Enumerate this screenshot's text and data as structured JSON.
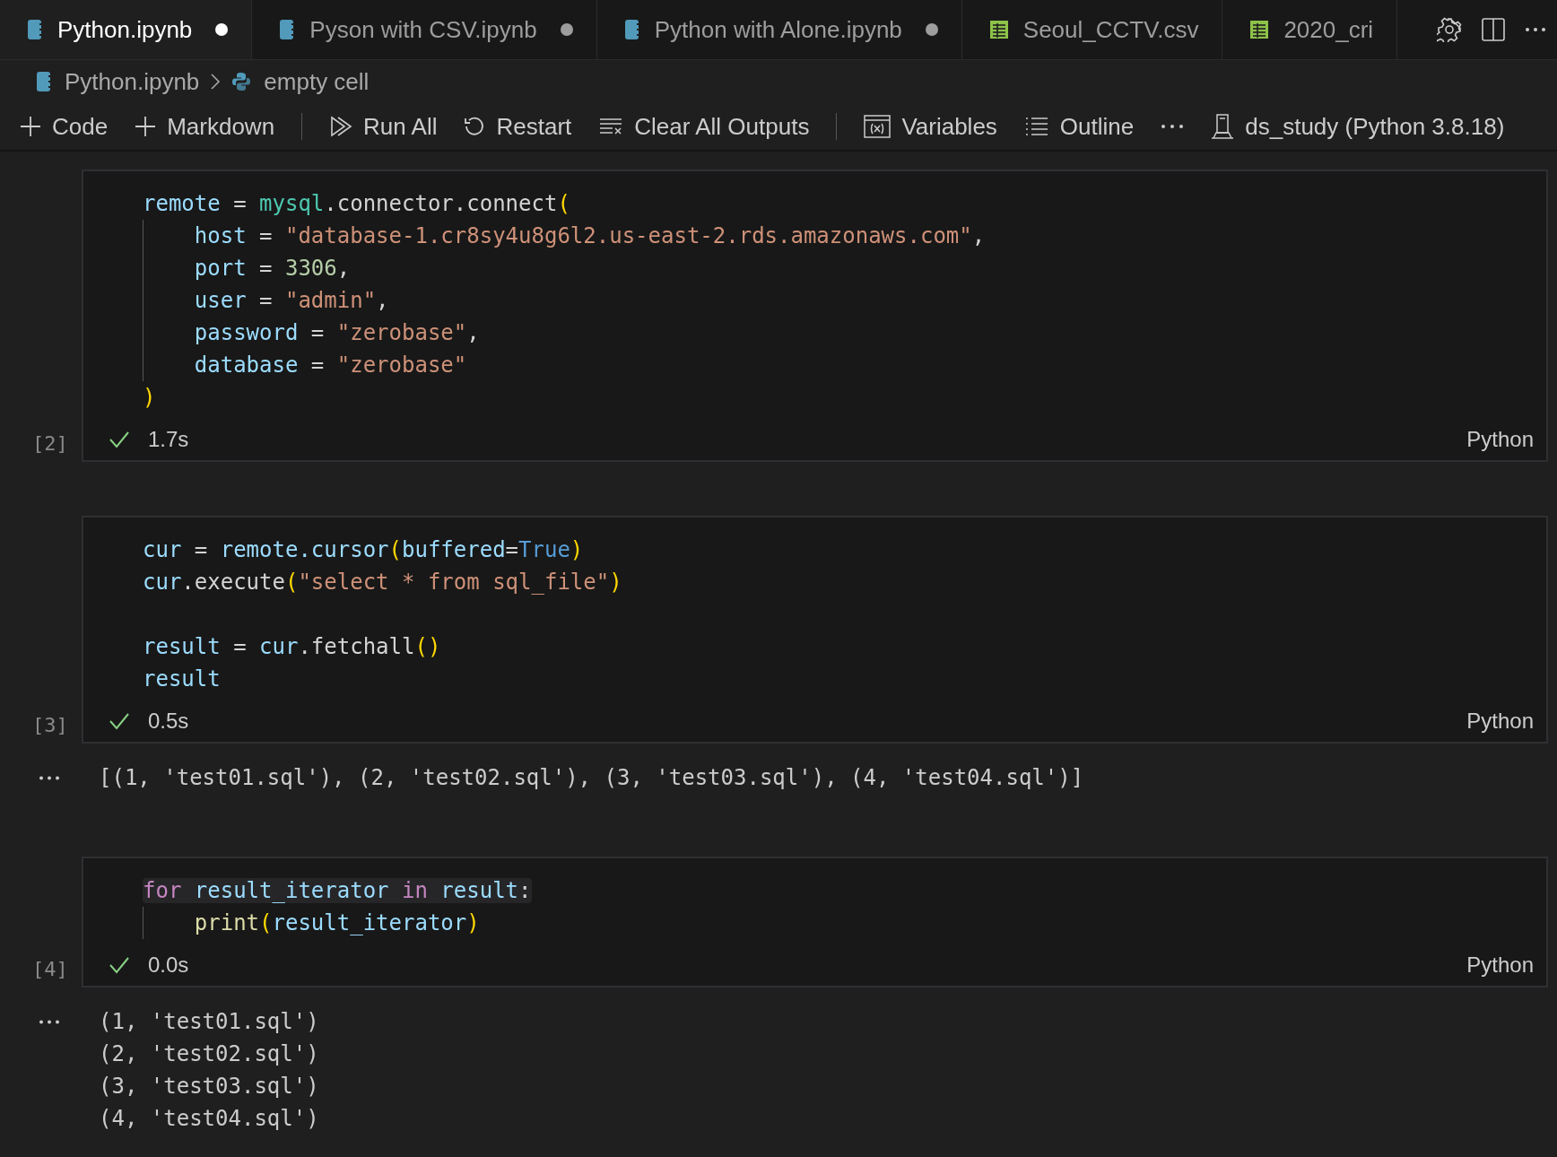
{
  "tabs": [
    {
      "label": "Python.ipynb",
      "kind": "notebook",
      "selected": true,
      "dirty": true
    },
    {
      "label": "Pyson with CSV.ipynb",
      "kind": "notebook",
      "selected": false,
      "dirty": true
    },
    {
      "label": "Python with Alone.ipynb",
      "kind": "notebook",
      "selected": false,
      "dirty": true
    },
    {
      "label": "Seoul_CCTV.csv",
      "kind": "csv",
      "selected": false,
      "dirty": false
    },
    {
      "label": "2020_cri",
      "kind": "csv",
      "selected": false,
      "dirty": false
    }
  ],
  "breadcrumb": [
    {
      "label": "Python.ipynb",
      "kind": "notebook"
    },
    {
      "label": "empty cell",
      "kind": "python"
    }
  ],
  "toolbar": [
    {
      "label": "Code",
      "kind": "plus"
    },
    {
      "label": "Markdown",
      "kind": "plus"
    },
    {
      "kind": "separator"
    },
    {
      "label": "Run All",
      "kind": "run"
    },
    {
      "label": "Restart",
      "kind": "restart"
    },
    {
      "label": "Clear All Outputs",
      "kind": "clear"
    },
    {
      "kind": "separator"
    },
    {
      "label": "Variables",
      "kind": "variables"
    },
    {
      "label": "Outline",
      "kind": "outline"
    },
    {
      "kind": "more"
    },
    {
      "label": "ds_study (Python 3.8.18)",
      "kind": "kernel"
    }
  ],
  "cells": [
    {
      "execution_count": "[2]",
      "succeeded": true,
      "duration": "1.7s",
      "language": "Python",
      "blocks": [
        {
          "lines": [
            {
              "highlighted": false,
              "indent_guide": false,
              "tokens": [
                {
                  "color": "#9cdcfe",
                  "t": "remote"
                },
                {
                  "color": "#d4d4d4",
                  "t": " = "
                },
                {
                  "color": "#4ec9b0",
                  "t": "mysql"
                },
                {
                  "color": "#d4d4d4",
                  "t": ".connector.connect"
                },
                {
                  "color": "#ffd700",
                  "t": "("
                }
              ]
            },
            {
              "highlighted": false,
              "indent_guide": true,
              "tokens": [
                {
                  "color": "#9cdcfe",
                  "t": "    host"
                },
                {
                  "color": "#d4d4d4",
                  "t": " = "
                },
                {
                  "color": "#ce9178",
                  "t": "\"database-1.cr8sy4u8g6l2.us-east-2.rds.amazonaws.com\""
                },
                {
                  "color": "#d4d4d4",
                  "t": ","
                }
              ]
            },
            {
              "highlighted": false,
              "indent_guide": true,
              "tokens": [
                {
                  "color": "#9cdcfe",
                  "t": "    port"
                },
                {
                  "color": "#d4d4d4",
                  "t": " = "
                },
                {
                  "color": "#b5cea8",
                  "t": "3306"
                },
                {
                  "color": "#d4d4d4",
                  "t": ","
                }
              ]
            },
            {
              "highlighted": false,
              "indent_guide": true,
              "tokens": [
                {
                  "color": "#9cdcfe",
                  "t": "    user"
                },
                {
                  "color": "#d4d4d4",
                  "t": " = "
                },
                {
                  "color": "#ce9178",
                  "t": "\"admin\""
                },
                {
                  "color": "#d4d4d4",
                  "t": ","
                }
              ]
            },
            {
              "highlighted": false,
              "indent_guide": true,
              "tokens": [
                {
                  "color": "#9cdcfe",
                  "t": "    password"
                },
                {
                  "color": "#d4d4d4",
                  "t": " = "
                },
                {
                  "color": "#ce9178",
                  "t": "\"zerobase\""
                },
                {
                  "color": "#d4d4d4",
                  "t": ","
                }
              ]
            },
            {
              "highlighted": false,
              "indent_guide": true,
              "tokens": [
                {
                  "color": "#9cdcfe",
                  "t": "    database"
                },
                {
                  "color": "#d4d4d4",
                  "t": " = "
                },
                {
                  "color": "#ce9178",
                  "t": "\"zerobase\""
                }
              ]
            },
            {
              "highlighted": false,
              "indent_guide": false,
              "tokens": [
                {
                  "color": "#ffd700",
                  "t": ")"
                }
              ]
            }
          ]
        }
      ]
    },
    {
      "execution_count": "[3]",
      "succeeded": true,
      "duration": "0.5s",
      "language": "Python",
      "blocks": [
        {
          "lines": [
            {
              "highlighted": false,
              "indent_guide": false,
              "tokens": [
                {
                  "color": "#9cdcfe",
                  "t": "cur"
                },
                {
                  "color": "#d4d4d4",
                  "t": " = "
                },
                {
                  "color": "#9cdcfe",
                  "t": "remote.cursor"
                },
                {
                  "color": "#ffd700",
                  "t": "("
                },
                {
                  "color": "#9cdcfe",
                  "t": "buffered"
                },
                {
                  "color": "#d4d4d4",
                  "t": "="
                },
                {
                  "color": "#569cd6",
                  "t": "True"
                },
                {
                  "color": "#ffd700",
                  "t": ")"
                }
              ]
            },
            {
              "highlighted": false,
              "indent_guide": false,
              "tokens": [
                {
                  "color": "#9cdcfe",
                  "t": "cur"
                },
                {
                  "color": "#d4d4d4",
                  "t": ".execute"
                },
                {
                  "color": "#ffd700",
                  "t": "("
                },
                {
                  "color": "#ce9178",
                  "t": "\"select * from sql_file\""
                },
                {
                  "color": "#ffd700",
                  "t": ")"
                }
              ]
            }
          ]
        },
        {
          "lines": [
            {
              "highlighted": false,
              "indent_guide": false,
              "tokens": [
                {
                  "color": "#9cdcfe",
                  "t": "result"
                },
                {
                  "color": "#d4d4d4",
                  "t": " = "
                },
                {
                  "color": "#9cdcfe",
                  "t": "cur"
                },
                {
                  "color": "#d4d4d4",
                  "t": ".fetchall"
                },
                {
                  "color": "#ffd700",
                  "t": "()"
                }
              ]
            },
            {
              "highlighted": false,
              "indent_guide": false,
              "tokens": [
                {
                  "color": "#9cdcfe",
                  "t": "result"
                }
              ]
            }
          ]
        }
      ],
      "output": [
        "[(1, 'test01.sql'), (2, 'test02.sql'), (3, 'test03.sql'), (4, 'test04.sql')]"
      ]
    },
    {
      "execution_count": "[4]",
      "succeeded": true,
      "duration": "0.0s",
      "language": "Python",
      "blocks": [
        {
          "lines": [
            {
              "highlighted": true,
              "indent_guide": false,
              "tokens": [
                {
                  "color": "#c586c0",
                  "t": "for"
                },
                {
                  "color": "#9cdcfe",
                  "t": " result_iterator "
                },
                {
                  "color": "#c586c0",
                  "t": "in"
                },
                {
                  "color": "#9cdcfe",
                  "t": " result"
                },
                {
                  "color": "#d4d4d4",
                  "t": ":"
                }
              ]
            },
            {
              "highlighted": false,
              "indent_guide": true,
              "tokens": [
                {
                  "color": "#dcdcaa",
                  "t": "    print"
                },
                {
                  "color": "#ffd700",
                  "t": "("
                },
                {
                  "color": "#9cdcfe",
                  "t": "result_iterator"
                },
                {
                  "color": "#ffd700",
                  "t": ")"
                }
              ]
            }
          ]
        }
      ],
      "output": [
        "(1, 'test01.sql')",
        "(2, 'test02.sql')",
        "(3, 'test03.sql')",
        "(4, 'test04.sql')"
      ]
    }
  ]
}
